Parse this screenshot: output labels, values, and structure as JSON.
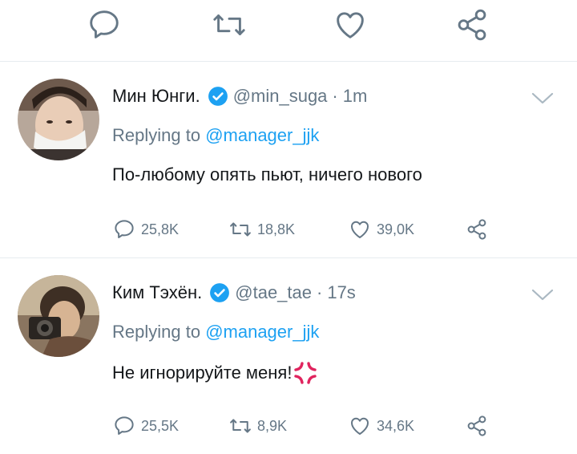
{
  "top_actions": {
    "reply_icon": "reply-icon",
    "retweet_icon": "retweet-icon",
    "like_icon": "heart-icon",
    "share_icon": "share-icon"
  },
  "tweets": [
    {
      "name": "Мин Юнги.",
      "handle": "@min_suga",
      "separator": "·",
      "time": "1m",
      "reply_prefix": "Replying to ",
      "reply_to": "@manager_jjk",
      "text": "По-любому опять пьют, ничего нового",
      "emoji": "",
      "replies": "25,8K",
      "retweets": "18,8K",
      "likes": "39,0K"
    },
    {
      "name": "Ким Тэхён.",
      "handle": "@tae_tae",
      "separator": "·",
      "time": "17s",
      "reply_prefix": "Replying to ",
      "reply_to": "@manager_jjk",
      "text": "Не игнорируйте меня!",
      "emoji": "anger-symbol",
      "replies": "25,5K",
      "retweets": "8,9K",
      "likes": "34,6K"
    }
  ],
  "colors": {
    "icon_gray": "#657786",
    "link_blue": "#1da1f2",
    "divider": "#e6ecf0",
    "anger_red": "#e0245e"
  }
}
